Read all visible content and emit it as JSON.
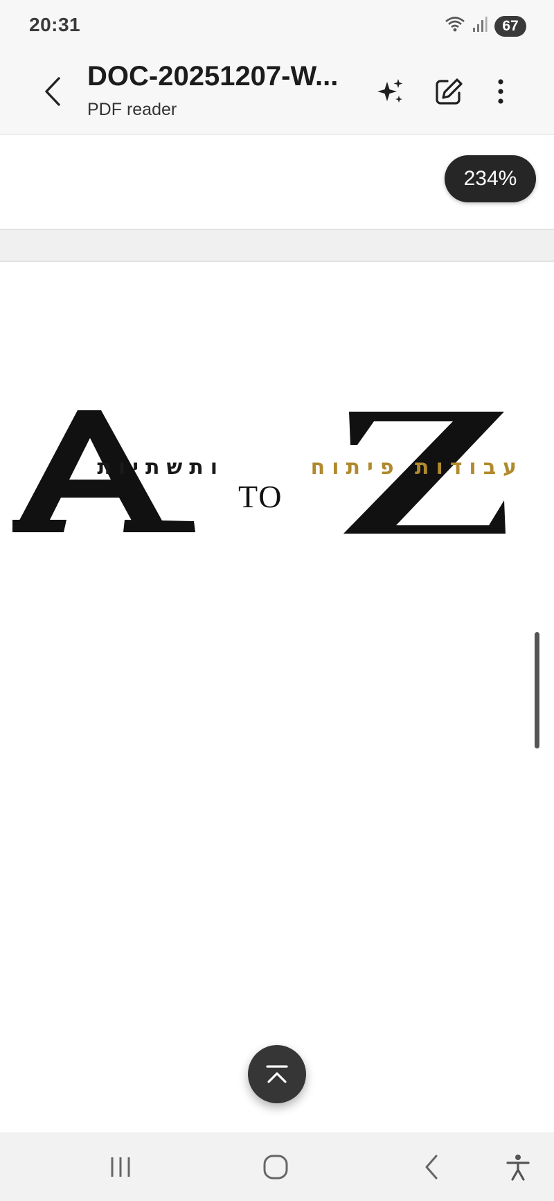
{
  "status_bar": {
    "time": "20:31",
    "battery": "67",
    "icons": [
      "wifi-icon",
      "signal-icon",
      "battery-icon"
    ]
  },
  "app_bar": {
    "title": "DOC-20251207-W...",
    "subtitle": "PDF reader",
    "actions": [
      "back-icon",
      "ai-sparkle-icon",
      "edit-icon",
      "more-icon"
    ]
  },
  "viewer": {
    "zoom": "234%",
    "logo": {
      "hebrew_gold": "עבודות פיתוח",
      "hebrew_black": "ותשתיות",
      "to_text": "TO",
      "letter_left": "A",
      "letter_right": "Z"
    }
  },
  "nav_bar": {
    "items": [
      "recents-icon",
      "home-icon",
      "back-nav-icon",
      "accessibility-icon"
    ]
  },
  "colors": {
    "accent_gold": "#b08a2e",
    "badge_bg": "#262626",
    "bar_bg": "#f7f7f7"
  }
}
